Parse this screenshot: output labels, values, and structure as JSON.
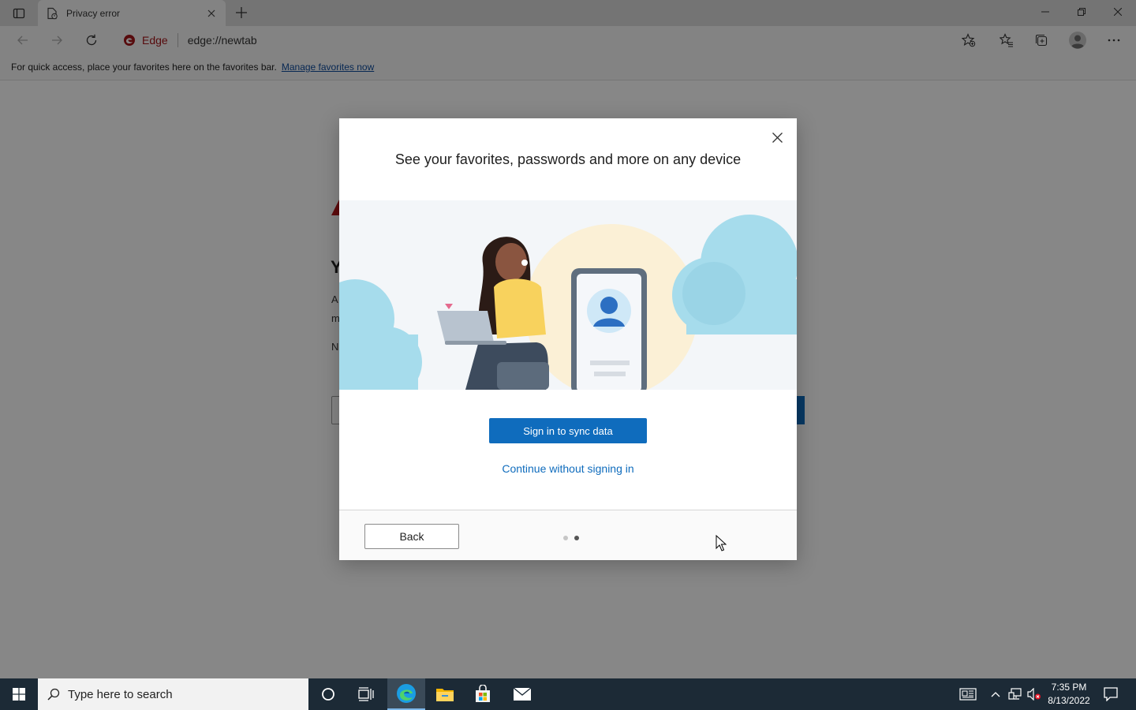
{
  "browser": {
    "tab_title": "Privacy error",
    "address_brand": "Edge",
    "url": "edge://newtab",
    "favorites_bar_text": "For quick access, place your favorites here on the favorites bar.",
    "favorites_bar_link": "Manage favorites now"
  },
  "background_page": {
    "heading_fragment": "Y",
    "line1_fragment": "A",
    "line2_fragment": "m",
    "line3_fragment": "N"
  },
  "dialog": {
    "title": "See your favorites, passwords and more on any device",
    "primary_button": "Sign in to sync data",
    "secondary_link": "Continue without signing in",
    "back_button": "Back",
    "pager": {
      "total": 2,
      "current": 2
    }
  },
  "taskbar": {
    "search_placeholder": "Type here to search",
    "time": "7:35 PM",
    "date": "8/13/2022"
  },
  "colors": {
    "accent": "#0f6cbd",
    "edge_brand": "#a5151a",
    "taskbar": "#1c2a36"
  }
}
